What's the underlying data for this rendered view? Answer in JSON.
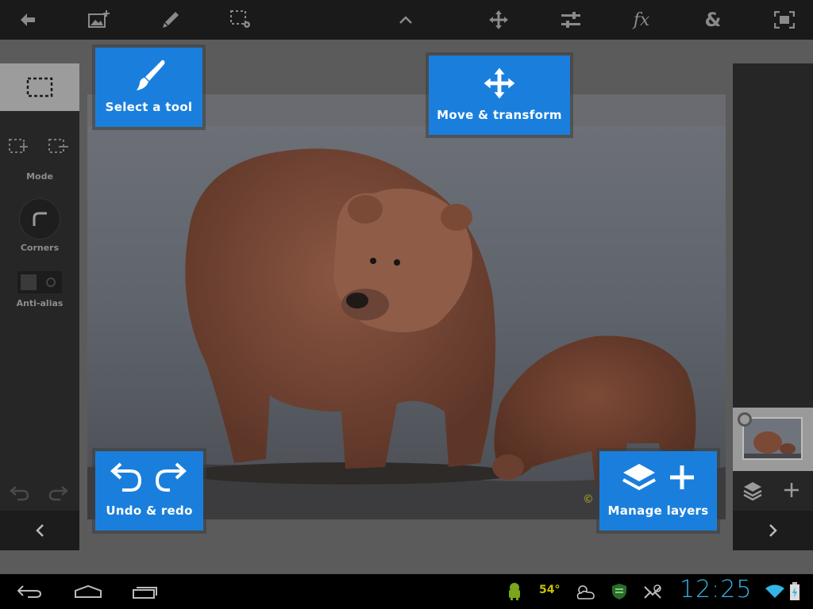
{
  "toolbar": {
    "icons": [
      "back-arrow-icon",
      "add-image-icon",
      "brush-icon",
      "selection-settings-icon",
      "chevron-up-icon",
      "move-icon",
      "adjustments-icon",
      "fx-icon",
      "ampersand-icon",
      "fullscreen-icon"
    ],
    "fx_label": "fx",
    "amp_label": "&"
  },
  "left_panel": {
    "mode_label": "Mode",
    "corners_label": "Corners",
    "antialias_label": "Anti-alias"
  },
  "callouts": {
    "select_tool": "Select a tool",
    "move_transform": "Move & transform",
    "undo_redo": "Undo & redo",
    "manage_layers": "Manage layers"
  },
  "status_bar": {
    "temperature": "54°",
    "clock": "12:25"
  },
  "colors": {
    "accent": "#1a7fdc",
    "clock": "#33b5e5",
    "toolbar": "#1a1a1a"
  }
}
